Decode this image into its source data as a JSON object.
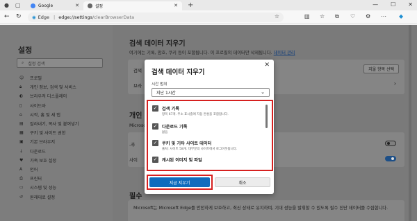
{
  "browser": {
    "tabs": [
      {
        "label": "Google",
        "active": false
      },
      {
        "label": "설정",
        "active": true
      }
    ],
    "url": {
      "brand": "Edge",
      "separator": "|",
      "host": "edge://settings",
      "path": "/clearBrowserData"
    }
  },
  "sidebar": {
    "title": "설정",
    "search_placeholder": "설정 검색",
    "items": [
      {
        "icon": "profile-icon",
        "label": "프로필"
      },
      {
        "icon": "lock-icon",
        "label": "개인 정보, 검색 및 서비스"
      },
      {
        "icon": "appearance-icon",
        "label": "브라우저 디스플레이"
      },
      {
        "icon": "sidebar-icon",
        "label": "사이드바"
      },
      {
        "icon": "home-icon",
        "label": "시작, 홈 및 새 탭"
      },
      {
        "icon": "clipboard-icon",
        "label": "잘라내기, 복사 및 붙여넣기"
      },
      {
        "icon": "cookie-icon",
        "label": "쿠키 및 사이트 권한"
      },
      {
        "icon": "browser-icon",
        "label": "기본 브라우저"
      },
      {
        "icon": "download-icon",
        "label": "다운로드"
      },
      {
        "icon": "family-icon",
        "label": "가족 보호 설정"
      },
      {
        "icon": "language-icon",
        "label": "언어"
      },
      {
        "icon": "printer-icon",
        "label": "프린터"
      },
      {
        "icon": "system-icon",
        "label": "시스템 및 성능"
      },
      {
        "icon": "reset-icon",
        "label": "원래대로 설정"
      }
    ]
  },
  "content": {
    "clear_section": {
      "title": "검색 데이터 지우기",
      "desc": "여기에는 기록, 암호, 쿠키 등이 포함됩니다. 이 프로필의 데이터만 삭제됩니다.",
      "link": "데이터 관리",
      "row1_label": "검색",
      "row2_label": "브라",
      "choose_button": "지울 항목 선택"
    },
    "personal_section": {
      "title": "개인",
      "desc": "Microso",
      "row1_label": "-추",
      "row2_label": "사이"
    },
    "required_section": {
      "title": "필수",
      "text": "Microsoft는 Microsoft Edge를 안전하게 보호하고, 최신 상태로 유지하며, 기대 성능을 발휘할 수 있도록 필수 진단 데이터를 수집합니다."
    }
  },
  "modal": {
    "title": "검색 데이터 지우기",
    "close": "✕",
    "time_range_label": "시간 범위",
    "time_range_value": "지난 1시간",
    "options": [
      {
        "title": "검색 기록",
        "desc": "항목 67개. 주소 표시줄에 자동 완성을 포함합니다.",
        "checked": true
      },
      {
        "title": "다운로드 기록",
        "desc": "없음",
        "checked": true
      },
      {
        "title": "쿠키 및 기타 사이트 데이터",
        "desc": "출처: 사이트 58개. 대부분의 사이트에서 로그아웃됩니다.",
        "checked": true
      },
      {
        "title": "캐시된 이미지 및 파일",
        "desc": "",
        "checked": true
      }
    ],
    "clear_button": "지금 지우기",
    "cancel_button": "취소"
  },
  "colors": {
    "accent": "#0f6cbd",
    "highlight_box": "#d6201f"
  }
}
